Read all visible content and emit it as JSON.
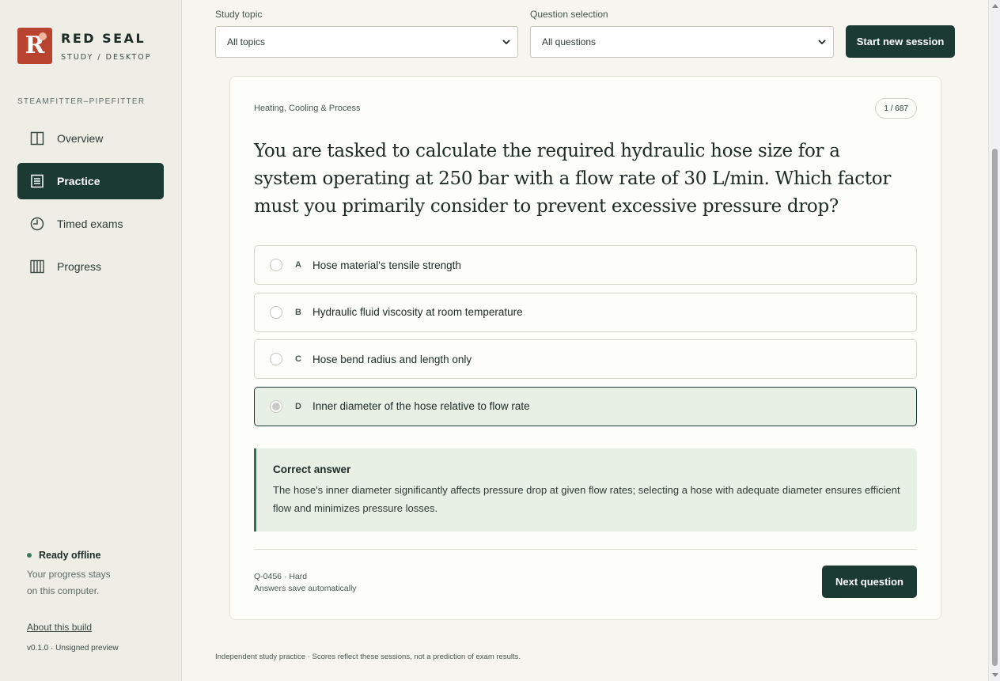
{
  "brand": {
    "logo_letter": "R",
    "title": "RED SEAL",
    "subtitle": "STUDY / DESKTOP"
  },
  "sidebar": {
    "trade": "STEAMFITTER–PIPEFITTER",
    "nav": [
      {
        "label": "Overview",
        "icon": "columns-icon",
        "active": false
      },
      {
        "label": "Practice",
        "icon": "list-icon",
        "active": true
      },
      {
        "label": "Timed exams",
        "icon": "clock-icon",
        "active": false
      },
      {
        "label": "Progress",
        "icon": "bars-icon",
        "active": false
      }
    ],
    "status_label": "Ready offline",
    "status_note": "Your progress stays on this computer.",
    "about_link": "About this build",
    "version": "v0.1.0 · Unsigned preview"
  },
  "filters": {
    "topic_label": "Study topic",
    "topic_value": "All topics",
    "selection_label": "Question selection",
    "selection_value": "All questions",
    "start_button": "Start new session"
  },
  "question_card": {
    "topic": "Heating, Cooling & Process",
    "counter": "1 / 687",
    "question": "You are tasked to calculate the required hydraulic hose size for a system operating at 250 bar with a flow rate of 30 L/min. Which factor must you primarily consider to prevent excessive pressure drop?",
    "options": [
      {
        "letter": "A",
        "text": "Hose material's tensile strength"
      },
      {
        "letter": "B",
        "text": "Hydraulic fluid viscosity at room temperature"
      },
      {
        "letter": "C",
        "text": "Hose bend radius and length only"
      },
      {
        "letter": "D",
        "text": "Inner diameter of the hose relative to flow rate"
      }
    ],
    "selected_option": "D",
    "feedback_title": "Correct answer",
    "feedback_text": "The hose's inner diameter significantly affects pressure drop at given flow rates; selecting a hose with adequate diameter ensures efficient flow and minimizes pressure losses.",
    "meta_id": "Q-0456 · Hard",
    "meta_save": "Answers save automatically",
    "next_button": "Next question"
  },
  "footer_note": "Independent study practice · Scores reflect these sessions, not a prediction of exam results.",
  "colors": {
    "accent": "#1b3a32",
    "brand": "#b8442f",
    "correct_bg": "#e8f0e6",
    "status_dot": "#3a7a5a"
  }
}
